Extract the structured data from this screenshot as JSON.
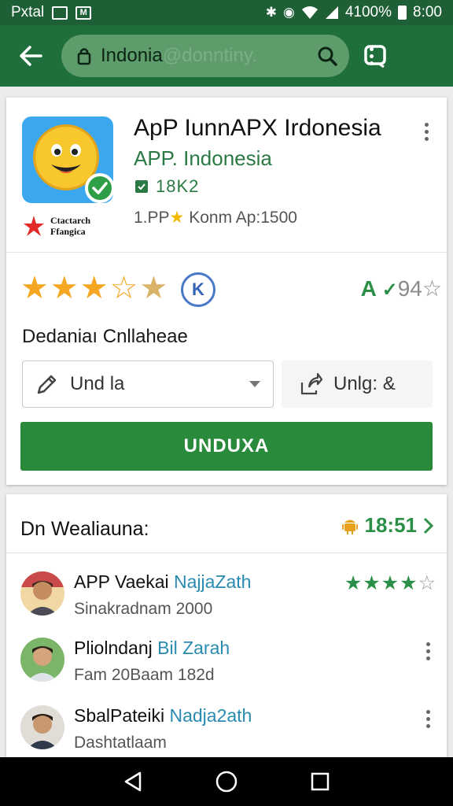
{
  "status_bar": {
    "carrier": "Pxtal",
    "battery_text": "4100%",
    "time": "8:00"
  },
  "toolbar": {
    "url_main": "Indonia",
    "url_faded": "@donntiny.",
    "icons": [
      "back-arrow-icon",
      "lock-icon",
      "search-icon",
      "tabs-icon",
      "more-vert-icon"
    ]
  },
  "app": {
    "title": "ApP IunnAPX Irdonesia",
    "developer": "APP. Indonesia",
    "badge_number": "18K2",
    "meta_prefix": "1.PP",
    "meta_suffix": "Konm Ap:1500",
    "brand_line1": "Ctactarch",
    "brand_line2": "Ffangica",
    "rating_circle_text": "K",
    "rating_right_main": "A",
    "rating_right_num": "94",
    "description_label": "Dedaniaı Cnllaheae",
    "select_value": "Und la",
    "share_label": "Unlg: &",
    "install_label": "UNDUXA",
    "star_rating": 3.5,
    "colors": {
      "accent": "#2a8a3c",
      "toolbar": "#1f6f3c",
      "star": "#f5a623"
    }
  },
  "reviews": {
    "heading": "Dn Wealiauna:",
    "count": "18:51",
    "items": [
      {
        "name": "APP Vaekai",
        "name_hl": "NajjaZath",
        "sub": "Sinakradnam 2000",
        "stars": 4
      },
      {
        "name": "Pliolndanj",
        "name_hl": "Bil Zarah",
        "sub": "Fam 20Baam 182d"
      },
      {
        "name": "SbalPateiki",
        "name_hl": "Nadja2ath",
        "sub": "Dashtatlaam"
      }
    ]
  },
  "nav": {
    "icons": [
      "back-triangle-icon",
      "home-circle-icon",
      "recents-square-icon"
    ]
  }
}
